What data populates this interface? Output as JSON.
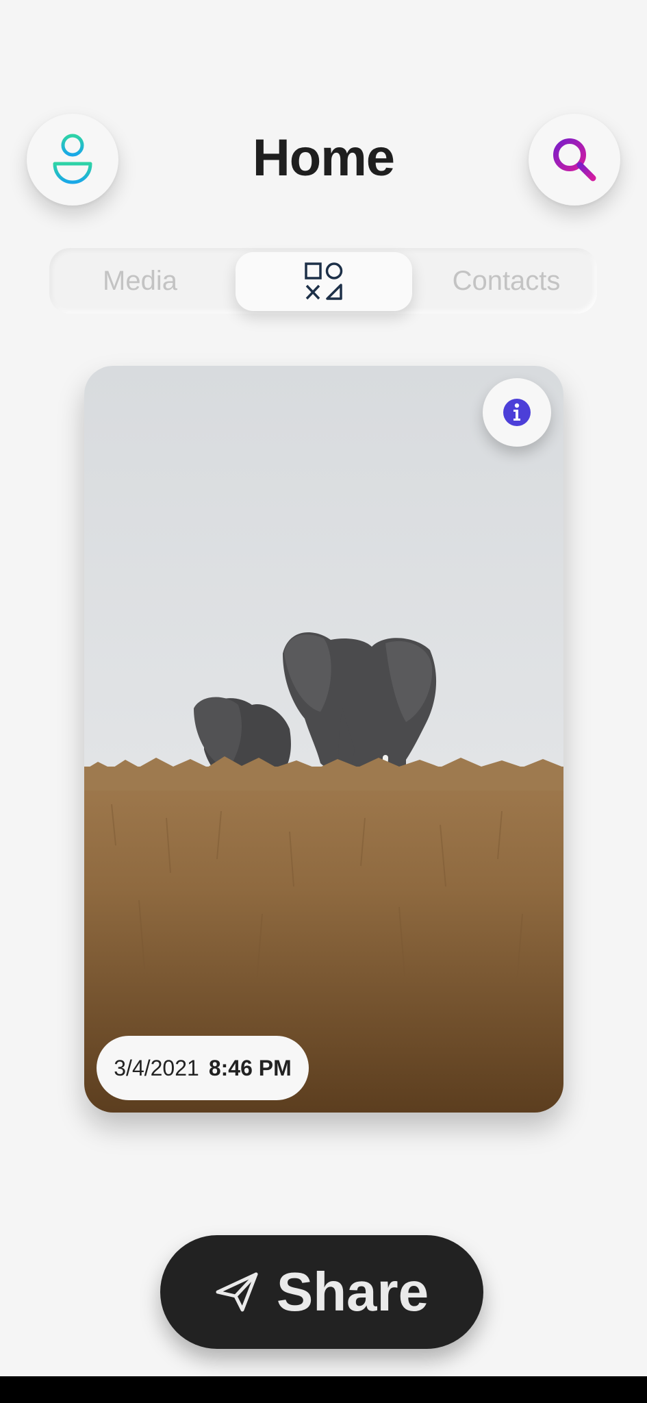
{
  "header": {
    "title": "Home",
    "profile_icon": "user-icon",
    "search_icon": "search-icon"
  },
  "tabs": [
    {
      "label": "Media",
      "selected": false
    },
    {
      "label": "",
      "icon": "shapes-icon",
      "selected": true
    },
    {
      "label": "Contacts",
      "selected": false
    }
  ],
  "card": {
    "image": "elephants-in-grassland",
    "info_icon": "info-icon",
    "date": "3/4/2021",
    "time": "8:46 PM"
  },
  "share_button": {
    "label": "Share",
    "icon": "send-icon"
  },
  "colors": {
    "background": "#f5f5f5",
    "title": "#1f1f1f",
    "profile_gradient_start": "#2ed3a6",
    "profile_gradient_end": "#19a7e8",
    "search_gradient_start": "#7a1fc8",
    "search_gradient_end": "#d21ca0",
    "info_icon": "#4c3fd8",
    "tab_inactive": "#c3c3c3",
    "tab_icon": "#1d3048",
    "share_bg": "#222222"
  }
}
